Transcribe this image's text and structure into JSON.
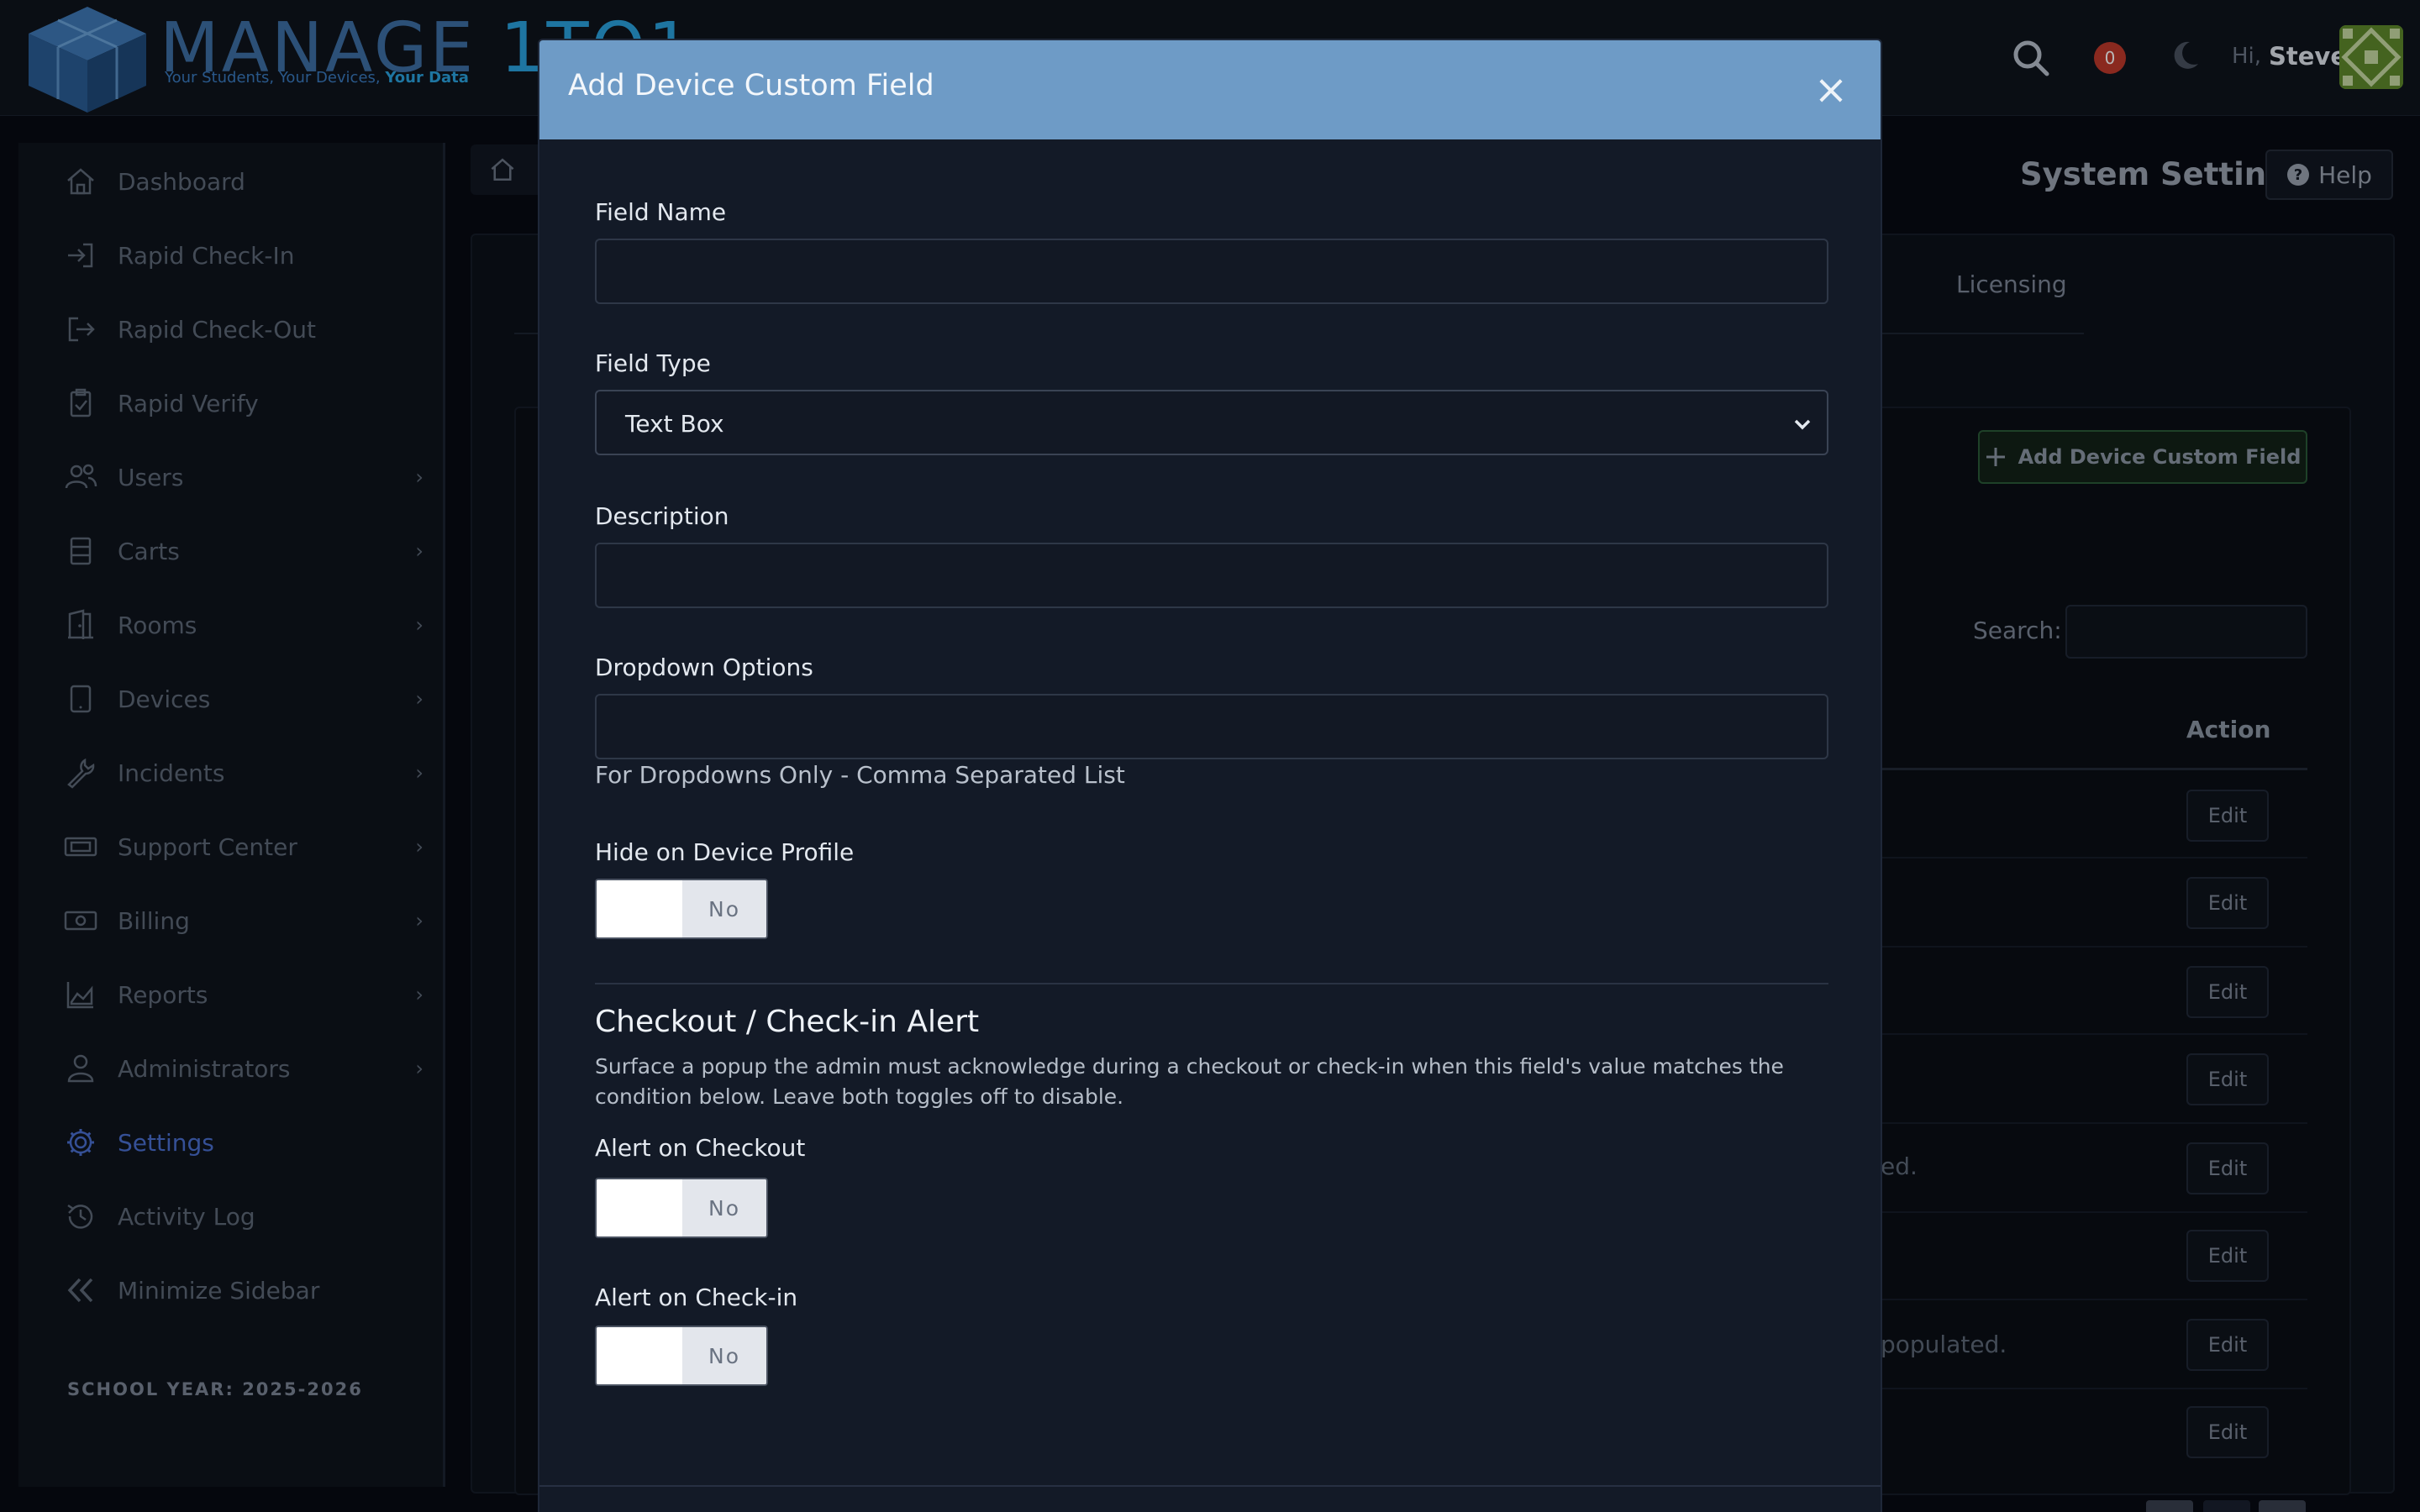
{
  "header": {
    "logo_text": "MANAGE",
    "logo_accent": "1TO1",
    "tagline_part1": "Your Students, Your Devices,",
    "tagline_part2": "Your Data",
    "notification_count": "0",
    "greeting": "Hi,",
    "user_name": "Steve"
  },
  "sidebar": {
    "items": [
      {
        "label": "Dashboard",
        "icon": "home-icon"
      },
      {
        "label": "Rapid Check-In",
        "icon": "sign-in-icon"
      },
      {
        "label": "Rapid Check-Out",
        "icon": "sign-out-icon"
      },
      {
        "label": "Rapid Verify",
        "icon": "clipboard-check-icon"
      },
      {
        "label": "Users",
        "icon": "users-icon"
      },
      {
        "label": "Carts",
        "icon": "cart-icon"
      },
      {
        "label": "Rooms",
        "icon": "door-icon"
      },
      {
        "label": "Devices",
        "icon": "tablet-icon"
      },
      {
        "label": "Incidents",
        "icon": "wrench-icon"
      },
      {
        "label": "Support Center",
        "icon": "ticket-icon"
      },
      {
        "label": "Billing",
        "icon": "money-icon"
      },
      {
        "label": "Reports",
        "icon": "chart-icon"
      },
      {
        "label": "Administrators",
        "icon": "admin-icon"
      },
      {
        "label": "Settings",
        "icon": "gear-icon"
      },
      {
        "label": "Activity Log",
        "icon": "history-icon"
      },
      {
        "label": "Minimize Sidebar",
        "icon": "double-chevron-left-icon"
      }
    ],
    "school_year": "SCHOOL YEAR: 2025-2026"
  },
  "page": {
    "title": "System Settings",
    "help_label": "Help",
    "tab_licensing": "Licensing",
    "add_button_label": "Add Device Custom Field",
    "search_label": "Search:",
    "action_header": "Action",
    "edit_label": "Edit",
    "row_fragment_1": "ed.",
    "row_fragment_2": "populated."
  },
  "modal": {
    "title": "Add Device Custom Field",
    "close_symbol": "×",
    "field_name_label": "Field Name",
    "field_name_value": "",
    "field_type_label": "Field Type",
    "field_type_value": "Text Box",
    "description_label": "Description",
    "description_value": "",
    "dropdown_options_label": "Dropdown Options",
    "dropdown_options_value": "",
    "dropdown_help": "For Dropdowns Only - Comma Separated List",
    "hide_label": "Hide on Device Profile",
    "toggle_off_label": "No",
    "section_title": "Checkout / Check-in Alert",
    "section_desc": "Surface a popup the admin must acknowledge during a checkout or check-in when this field's value matches the condition below. Leave both toggles off to disable.",
    "alert_checkout_label": "Alert on Checkout",
    "alert_checkin_label": "Alert on Check-in"
  },
  "colors": {
    "modal_header": "#6e9bc6",
    "active_nav": "#4a6fd0",
    "badge": "#c0392b"
  }
}
